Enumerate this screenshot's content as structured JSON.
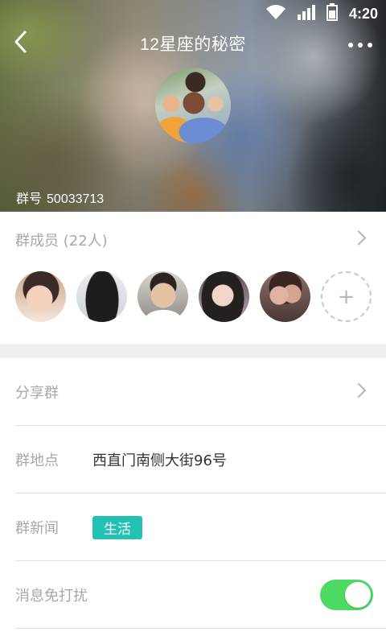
{
  "status_bar": {
    "time": "4:20"
  },
  "header": {
    "title": "12星座的秘密",
    "group_id_label": "群号",
    "group_id": "50033713"
  },
  "members": {
    "title": "群成员 (22人)",
    "avatars": [
      "member-1",
      "member-2",
      "member-3",
      "member-4",
      "member-5"
    ],
    "add_symbol": "+"
  },
  "settings": {
    "share": {
      "label": "分享群"
    },
    "location": {
      "label": "群地点",
      "value": "西直门南侧大街96号"
    },
    "news": {
      "label": "群新闻",
      "tag": "生活"
    },
    "mute": {
      "label": "消息免打扰",
      "enabled": true
    }
  },
  "colors": {
    "accent_tag": "#22c2b3",
    "toggle_on": "#4cd964",
    "label_gray": "#a8a8a8",
    "section_gap": "#efefef"
  }
}
